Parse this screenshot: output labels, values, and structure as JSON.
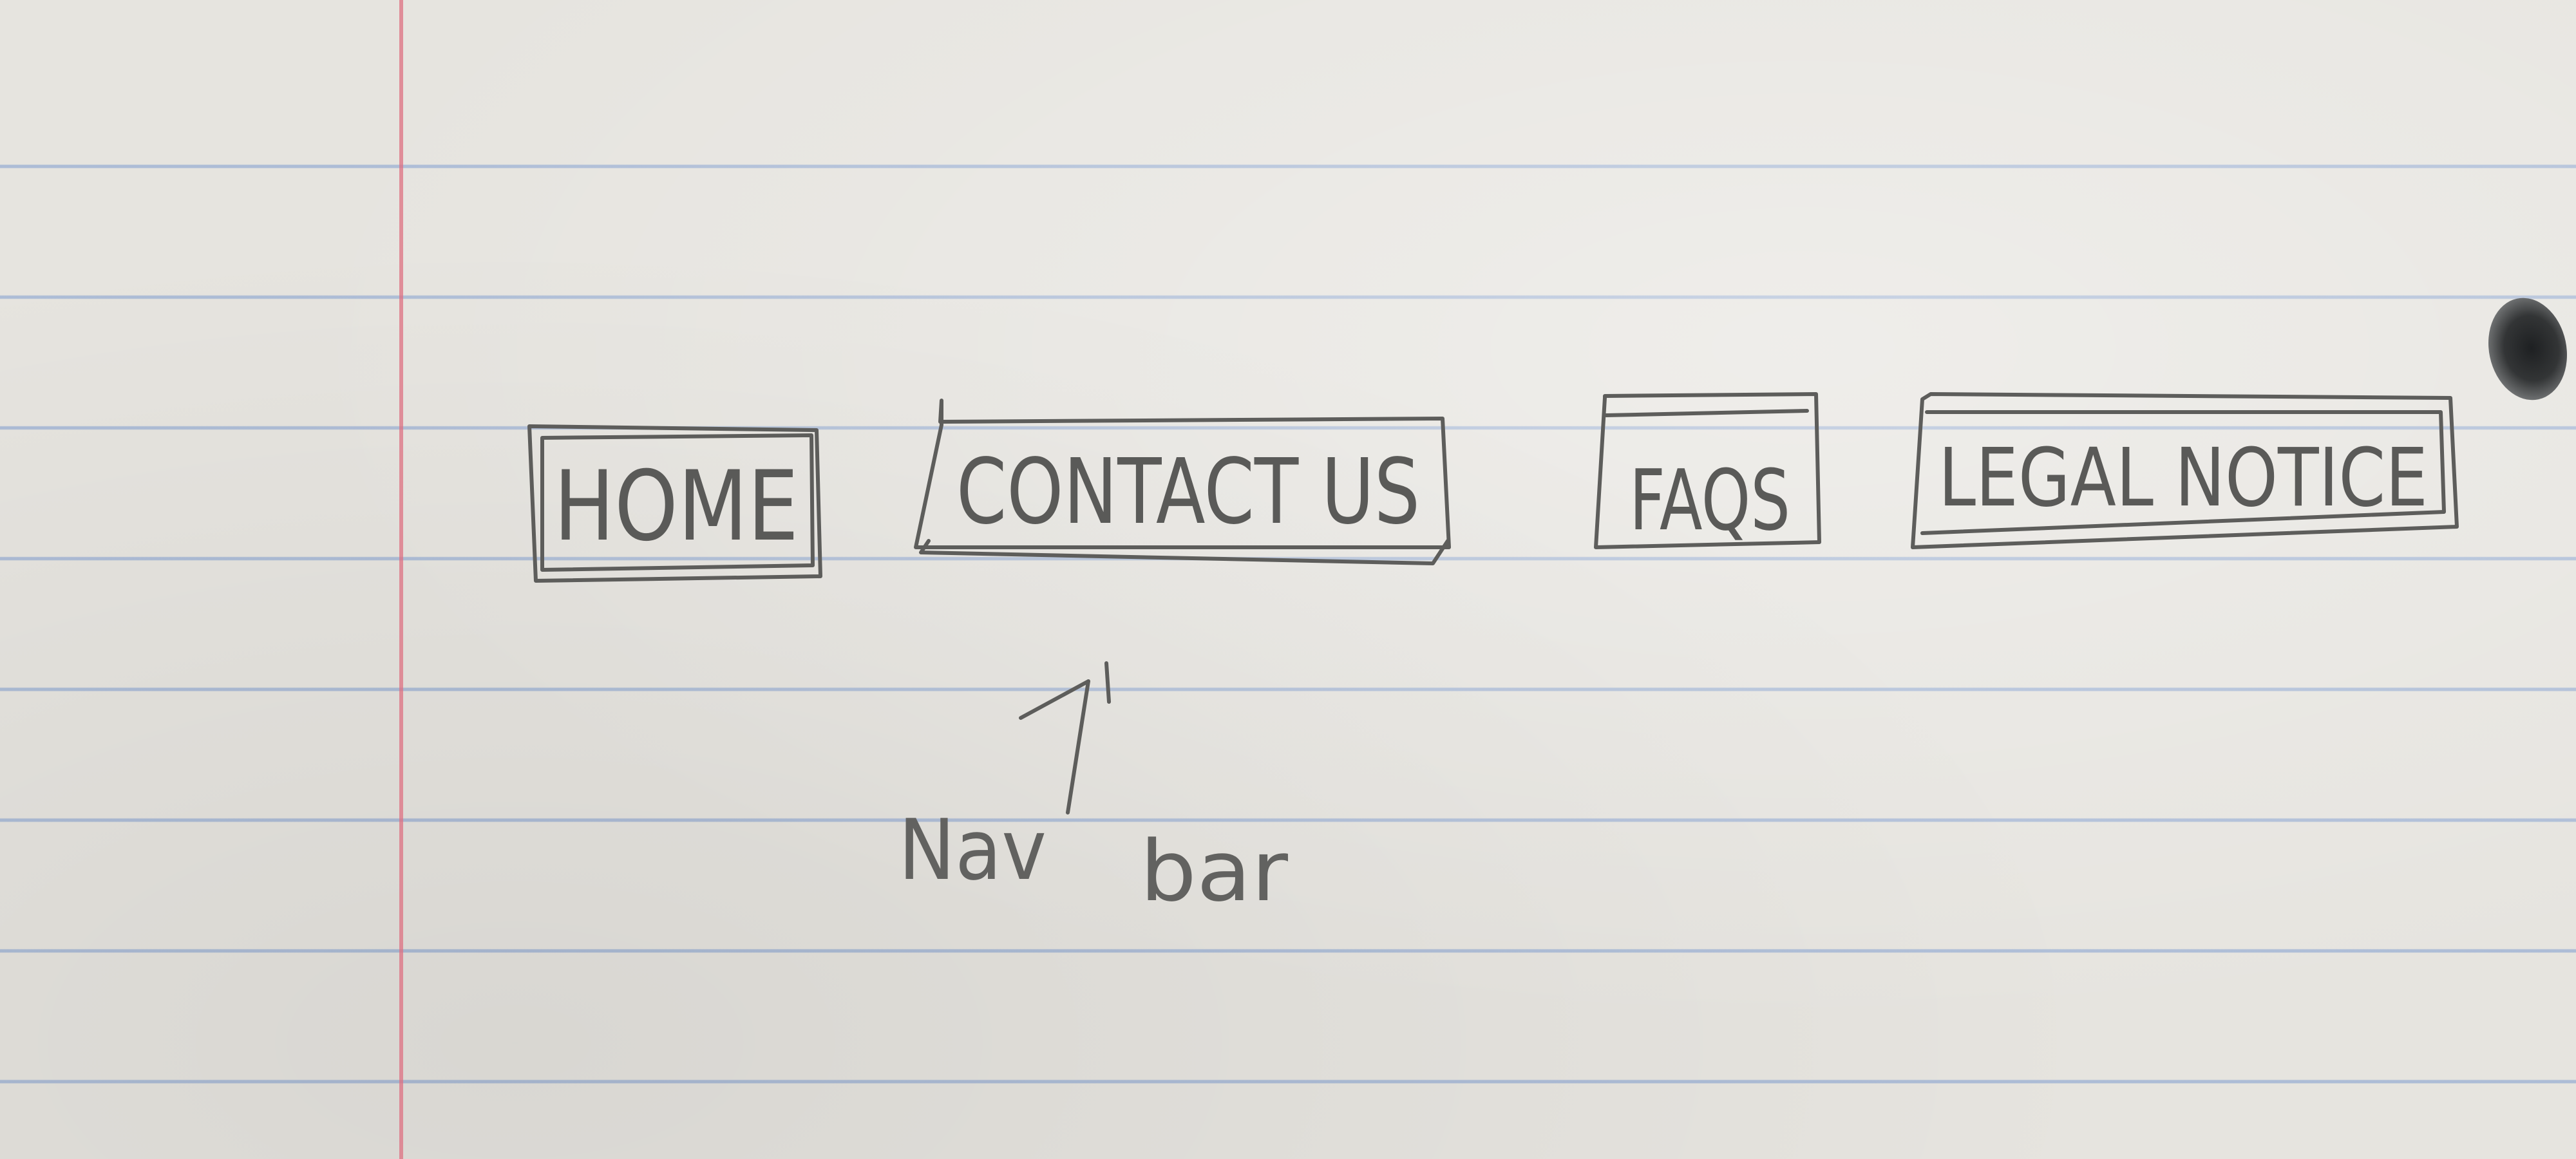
{
  "nav_bar": {
    "items": [
      {
        "label": "HOME"
      },
      {
        "label": "CONTACT US"
      },
      {
        "label": "FAQS"
      },
      {
        "label": "LEGAL NOTICE"
      }
    ]
  },
  "annotation": {
    "text_left": "Nav",
    "text_right": "bar"
  },
  "colors": {
    "paper": "#e6e4df",
    "ruled_line": "#7e9cce",
    "margin_line": "#de7082",
    "pencil": "#5d5d5b"
  }
}
